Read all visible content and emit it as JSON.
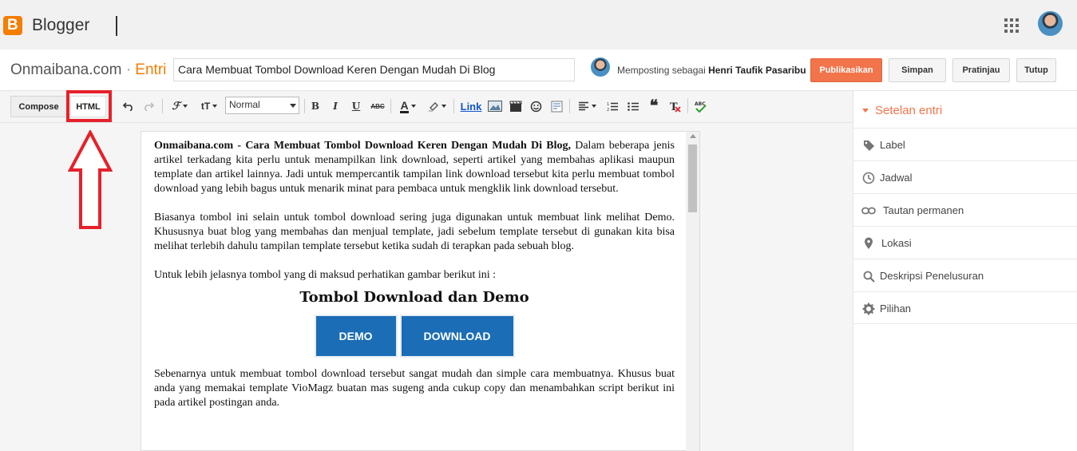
{
  "header": {
    "logo_letter": "B",
    "brand": "Blogger"
  },
  "titlebar": {
    "blog_name": "Onmaibana.com",
    "separator": "·",
    "section": "Entri",
    "post_title": "Cara Membuat Tombol Download Keren Dengan Mudah Di Blog",
    "posting_as_prefix": "Memposting sebagai",
    "posting_as_user": "Henri Taufik Pasaribu",
    "publish_label": "Publikasikan",
    "save_label": "Simpan",
    "preview_label": "Pratinjau",
    "close_label": "Tutup"
  },
  "toolbar": {
    "compose_label": "Compose",
    "html_label": "HTML",
    "font_size_value": "Normal",
    "bold": "B",
    "italic": "I",
    "underline": "U",
    "strike": "ABC",
    "link_label": "Link"
  },
  "post": {
    "p1_bold": "Onmaibana.com - Cara Membuat Tombol Download Keren Dengan Mudah Di Blog,",
    "p1_rest": " Dalam beberapa jenis artikel terkadang kita perlu untuk menampilkan link download, seperti artikel yang membahas aplikasi maupun template dan artikel lainnya.  Jadi untuk mempercantik tampilan link download tersebut kita perlu membuat tombol download yang lebih bagus untuk menarik minat para pembaca untuk mengklik link download tersebut.",
    "p2": "Biasanya tombol ini selain untuk tombol download sering juga digunakan untuk membuat link melihat Demo. Khususnya buat blog yang membahas dan menjual template, jadi sebelum template tersebut di gunakan kita bisa melihat terlebih dahulu tampilan template tersebut ketika sudah di terapkan pada sebuah blog.",
    "p3": "Untuk lebih jelasnya tombol yang di maksud perhatikan gambar berikut ini :",
    "image_title": "Tombol Download dan Demo",
    "demo_button": "DEMO",
    "download_button": "DOWNLOAD",
    "p4": "Sebenarnya untuk membuat tombol download tersebut sangat mudah dan simple cara membuatnya. Khusus buat anda yang memakai template VioMagz buatan mas sugeng anda cukup copy dan menambahkan script berikut ini pada artikel postingan anda."
  },
  "sidebar": {
    "heading": "Setelan entri",
    "items": [
      {
        "label": "Label",
        "icon": "label-icon"
      },
      {
        "label": "Jadwal",
        "icon": "clock-icon"
      },
      {
        "label": "Tautan permanen",
        "icon": "link-icon"
      },
      {
        "label": "Lokasi",
        "icon": "location-icon"
      },
      {
        "label": "Deskripsi Penelusuran",
        "icon": "search-icon"
      },
      {
        "label": "Pilihan",
        "icon": "gear-icon"
      }
    ]
  },
  "colors": {
    "brand_orange": "#f57d00",
    "publish": "#f2744a",
    "annotation_red": "#e5212b",
    "button_blue": "#1b6db5"
  }
}
